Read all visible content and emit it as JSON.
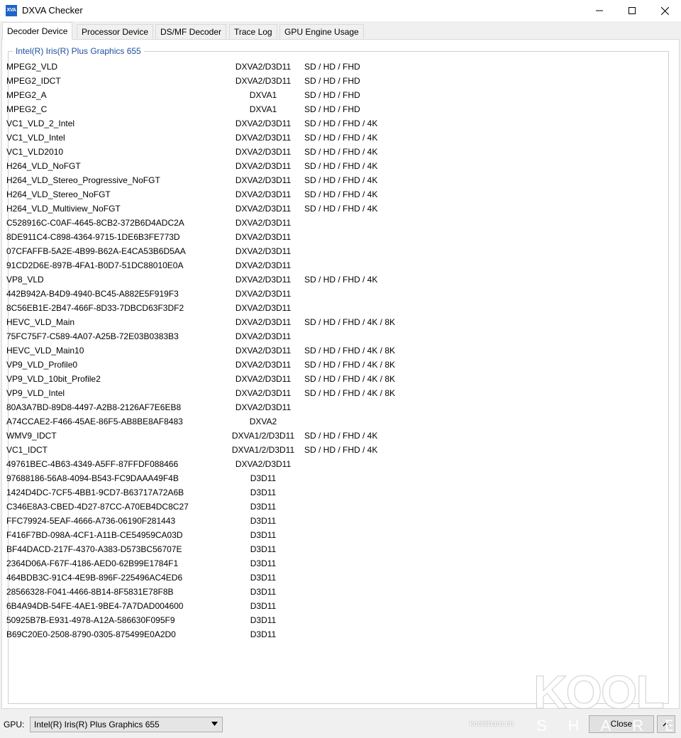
{
  "window": {
    "title": "DXVA Checker",
    "icon_text": "XVA"
  },
  "tabs": [
    {
      "label": "Decoder Device",
      "active": true
    },
    {
      "label": "Processor Device",
      "active": false
    },
    {
      "label": "DS/MF Decoder",
      "active": false
    },
    {
      "label": "Trace Log",
      "active": false
    },
    {
      "label": "GPU Engine Usage",
      "active": false
    }
  ],
  "group": {
    "title": "Intel(R) Iris(R) Plus Graphics 655"
  },
  "decoders": [
    {
      "name": "MPEG2_VLD",
      "api": "DXVA2/D3D11",
      "res": "SD / HD / FHD"
    },
    {
      "name": "MPEG2_IDCT",
      "api": "DXVA2/D3D11",
      "res": "SD / HD / FHD"
    },
    {
      "name": "MPEG2_A",
      "api": "DXVA1",
      "res": "SD / HD / FHD"
    },
    {
      "name": "MPEG2_C",
      "api": "DXVA1",
      "res": "SD / HD / FHD"
    },
    {
      "name": "VC1_VLD_2_Intel",
      "api": "DXVA2/D3D11",
      "res": "SD / HD / FHD / 4K"
    },
    {
      "name": "VC1_VLD_Intel",
      "api": "DXVA2/D3D11",
      "res": "SD / HD / FHD / 4K"
    },
    {
      "name": "VC1_VLD2010",
      "api": "DXVA2/D3D11",
      "res": "SD / HD / FHD / 4K"
    },
    {
      "name": "H264_VLD_NoFGT",
      "api": "DXVA2/D3D11",
      "res": "SD / HD / FHD / 4K"
    },
    {
      "name": "H264_VLD_Stereo_Progressive_NoFGT",
      "api": "DXVA2/D3D11",
      "res": "SD / HD / FHD / 4K"
    },
    {
      "name": "H264_VLD_Stereo_NoFGT",
      "api": "DXVA2/D3D11",
      "res": "SD / HD / FHD / 4K"
    },
    {
      "name": "H264_VLD_Multiview_NoFGT",
      "api": "DXVA2/D3D11",
      "res": "SD / HD / FHD / 4K"
    },
    {
      "name": "C528916C-C0AF-4645-8CB2-372B6D4ADC2A",
      "api": "DXVA2/D3D11",
      "res": ""
    },
    {
      "name": "8DE911C4-C898-4364-9715-1DE6B3FE773D",
      "api": "DXVA2/D3D11",
      "res": ""
    },
    {
      "name": "07CFAFFB-5A2E-4B99-B62A-E4CA53B6D5AA",
      "api": "DXVA2/D3D11",
      "res": ""
    },
    {
      "name": "91CD2D6E-897B-4FA1-B0D7-51DC88010E0A",
      "api": "DXVA2/D3D11",
      "res": ""
    },
    {
      "name": "VP8_VLD",
      "api": "DXVA2/D3D11",
      "res": "SD / HD / FHD / 4K"
    },
    {
      "name": "442B942A-B4D9-4940-BC45-A882E5F919F3",
      "api": "DXVA2/D3D11",
      "res": ""
    },
    {
      "name": "8C56EB1E-2B47-466F-8D33-7DBCD63F3DF2",
      "api": "DXVA2/D3D11",
      "res": ""
    },
    {
      "name": "HEVC_VLD_Main",
      "api": "DXVA2/D3D11",
      "res": "SD / HD / FHD / 4K / 8K"
    },
    {
      "name": "75FC75F7-C589-4A07-A25B-72E03B0383B3",
      "api": "DXVA2/D3D11",
      "res": ""
    },
    {
      "name": "HEVC_VLD_Main10",
      "api": "DXVA2/D3D11",
      "res": "SD / HD / FHD / 4K / 8K"
    },
    {
      "name": "VP9_VLD_Profile0",
      "api": "DXVA2/D3D11",
      "res": "SD / HD / FHD / 4K / 8K"
    },
    {
      "name": "VP9_VLD_10bit_Profile2",
      "api": "DXVA2/D3D11",
      "res": "SD / HD / FHD / 4K / 8K"
    },
    {
      "name": "VP9_VLD_Intel",
      "api": "DXVA2/D3D11",
      "res": "SD / HD / FHD / 4K / 8K"
    },
    {
      "name": "80A3A7BD-89D8-4497-A2B8-2126AF7E6EB8",
      "api": "DXVA2/D3D11",
      "res": ""
    },
    {
      "name": "A74CCAE2-F466-45AE-86F5-AB8BE8AF8483",
      "api": "DXVA2",
      "res": ""
    },
    {
      "name": "WMV9_IDCT",
      "api": "DXVA1/2/D3D11",
      "res": "SD / HD / FHD / 4K"
    },
    {
      "name": "VC1_IDCT",
      "api": "DXVA1/2/D3D11",
      "res": "SD / HD / FHD / 4K"
    },
    {
      "name": "49761BEC-4B63-4349-A5FF-87FFDF088466",
      "api": "DXVA2/D3D11",
      "res": ""
    },
    {
      "name": "97688186-56A8-4094-B543-FC9DAAA49F4B",
      "api": "D3D11",
      "res": ""
    },
    {
      "name": "1424D4DC-7CF5-4BB1-9CD7-B63717A72A6B",
      "api": "D3D11",
      "res": ""
    },
    {
      "name": "C346E8A3-CBED-4D27-87CC-A70EB4DC8C27",
      "api": "D3D11",
      "res": ""
    },
    {
      "name": "FFC79924-5EAF-4666-A736-06190F281443",
      "api": "D3D11",
      "res": ""
    },
    {
      "name": "F416F7BD-098A-4CF1-A11B-CE54959CA03D",
      "api": "D3D11",
      "res": ""
    },
    {
      "name": "BF44DACD-217F-4370-A383-D573BC56707E",
      "api": "D3D11",
      "res": ""
    },
    {
      "name": "2364D06A-F67F-4186-AED0-62B99E1784F1",
      "api": "D3D11",
      "res": ""
    },
    {
      "name": "464BDB3C-91C4-4E9B-896F-225496AC4ED6",
      "api": "D3D11",
      "res": ""
    },
    {
      "name": "28566328-F041-4466-8B14-8F5831E78F8B",
      "api": "D3D11",
      "res": ""
    },
    {
      "name": "6B4A94DB-54FE-4AE1-9BE4-7A7DAD004600",
      "api": "D3D11",
      "res": ""
    },
    {
      "name": "50925B7B-E931-4978-A12A-586630F095F9",
      "api": "D3D11",
      "res": ""
    },
    {
      "name": "B69C20E0-2508-8790-0305-875499E0A2D0",
      "api": "D3D11",
      "res": ""
    }
  ],
  "status": {
    "gpu_label": "GPU:",
    "gpu_value": "Intel(R) Iris(R) Plus Graphics 655",
    "close_label": "Close"
  },
  "watermark": {
    "logo_text": "KOOL",
    "sub_text": "SHARE",
    "url": "koolshare.cn"
  }
}
